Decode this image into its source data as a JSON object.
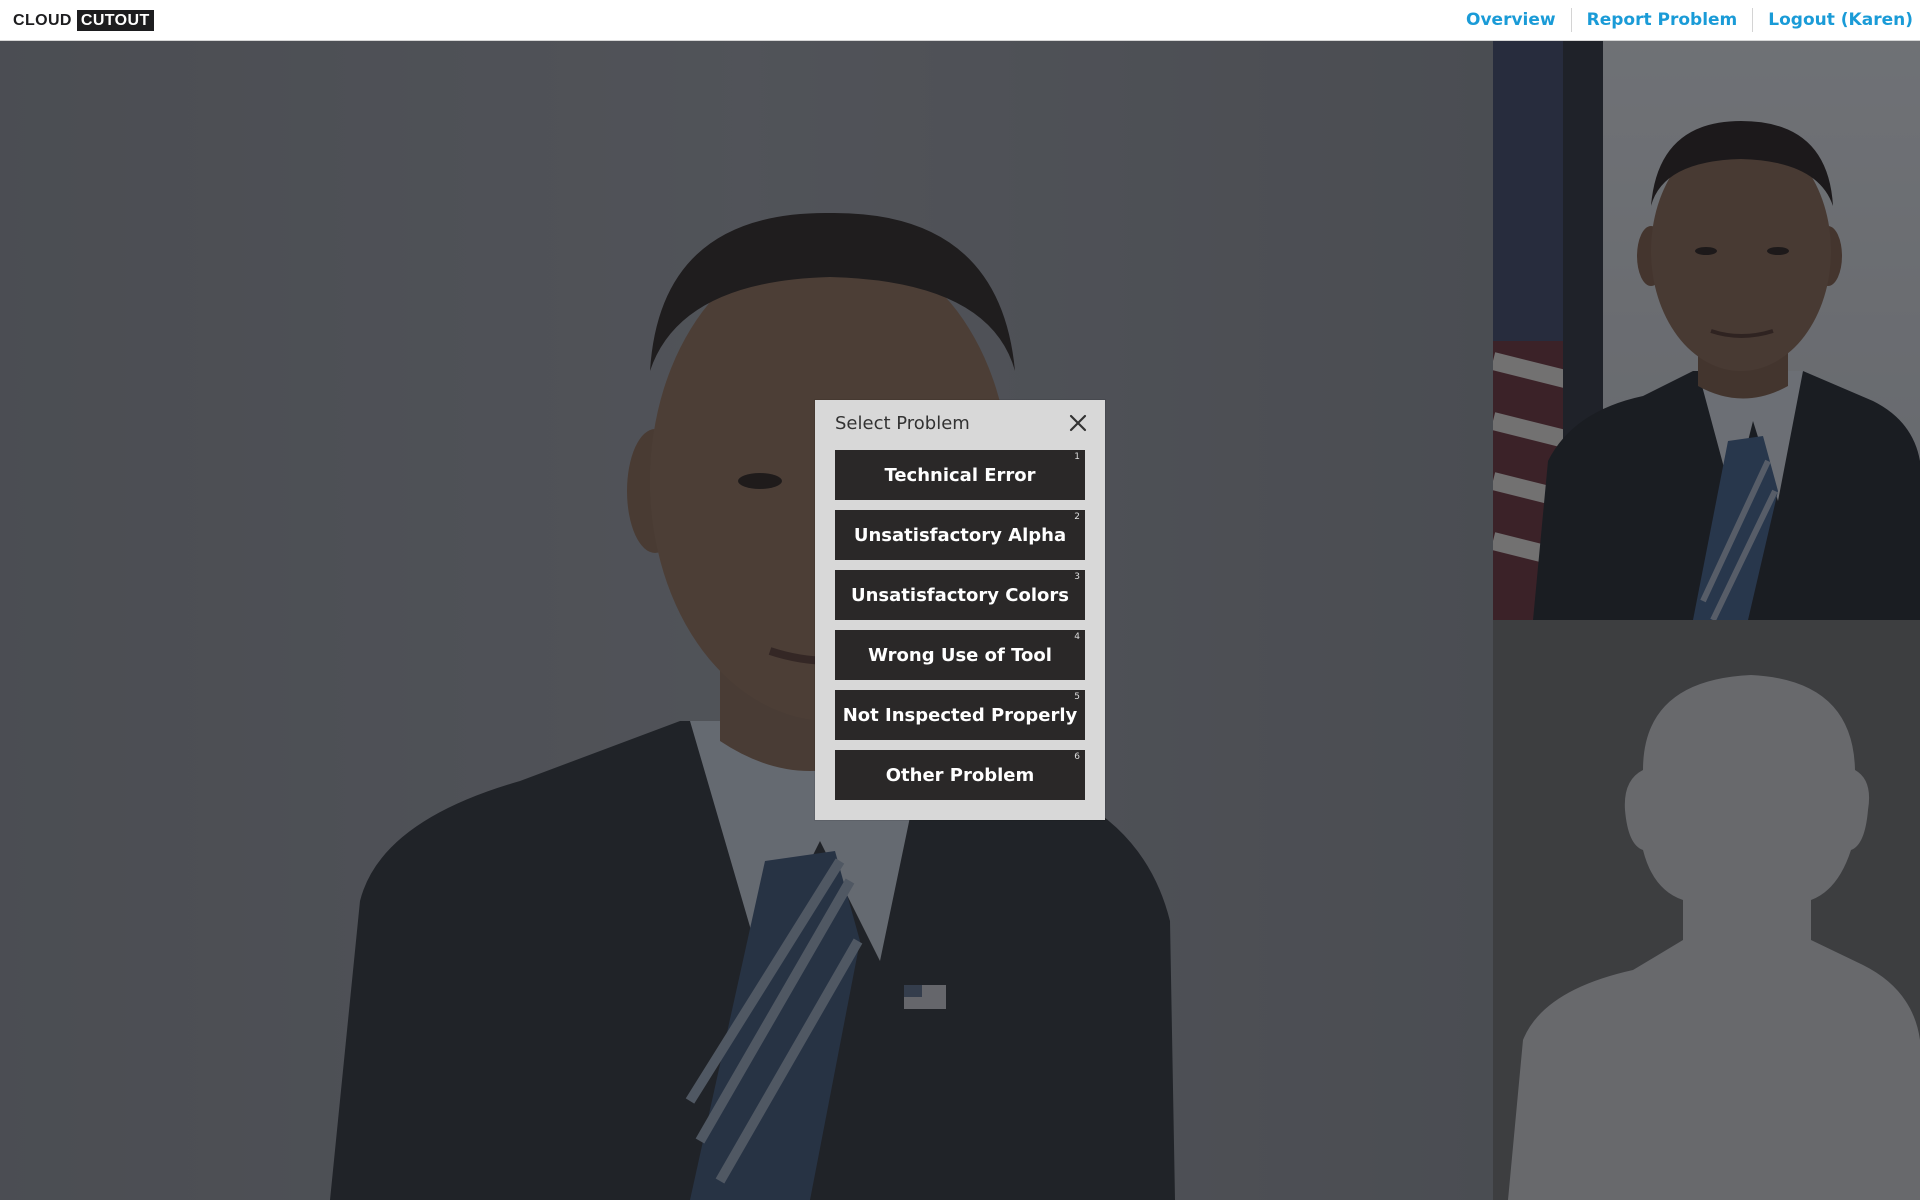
{
  "app": {
    "logo_part1": "CLOUD",
    "logo_part2": "CUTOUT"
  },
  "nav": {
    "overview": "Overview",
    "report_problem": "Report Problem",
    "logout": "Logout (Karen)"
  },
  "modal": {
    "title": "Select Problem",
    "close_icon": "close-icon",
    "options": [
      {
        "label": "Technical Error",
        "key": "1"
      },
      {
        "label": "Unsatisfactory Alpha",
        "key": "2"
      },
      {
        "label": "Unsatisfactory Colors",
        "key": "3"
      },
      {
        "label": "Wrong Use of Tool",
        "key": "4"
      },
      {
        "label": "Not Inspected Properly",
        "key": "5"
      },
      {
        "label": "Other Problem",
        "key": "6"
      }
    ]
  },
  "colors": {
    "accent": "#1a9bd7",
    "button_bg": "#2a2828",
    "modal_bg": "#d8d8d8"
  }
}
